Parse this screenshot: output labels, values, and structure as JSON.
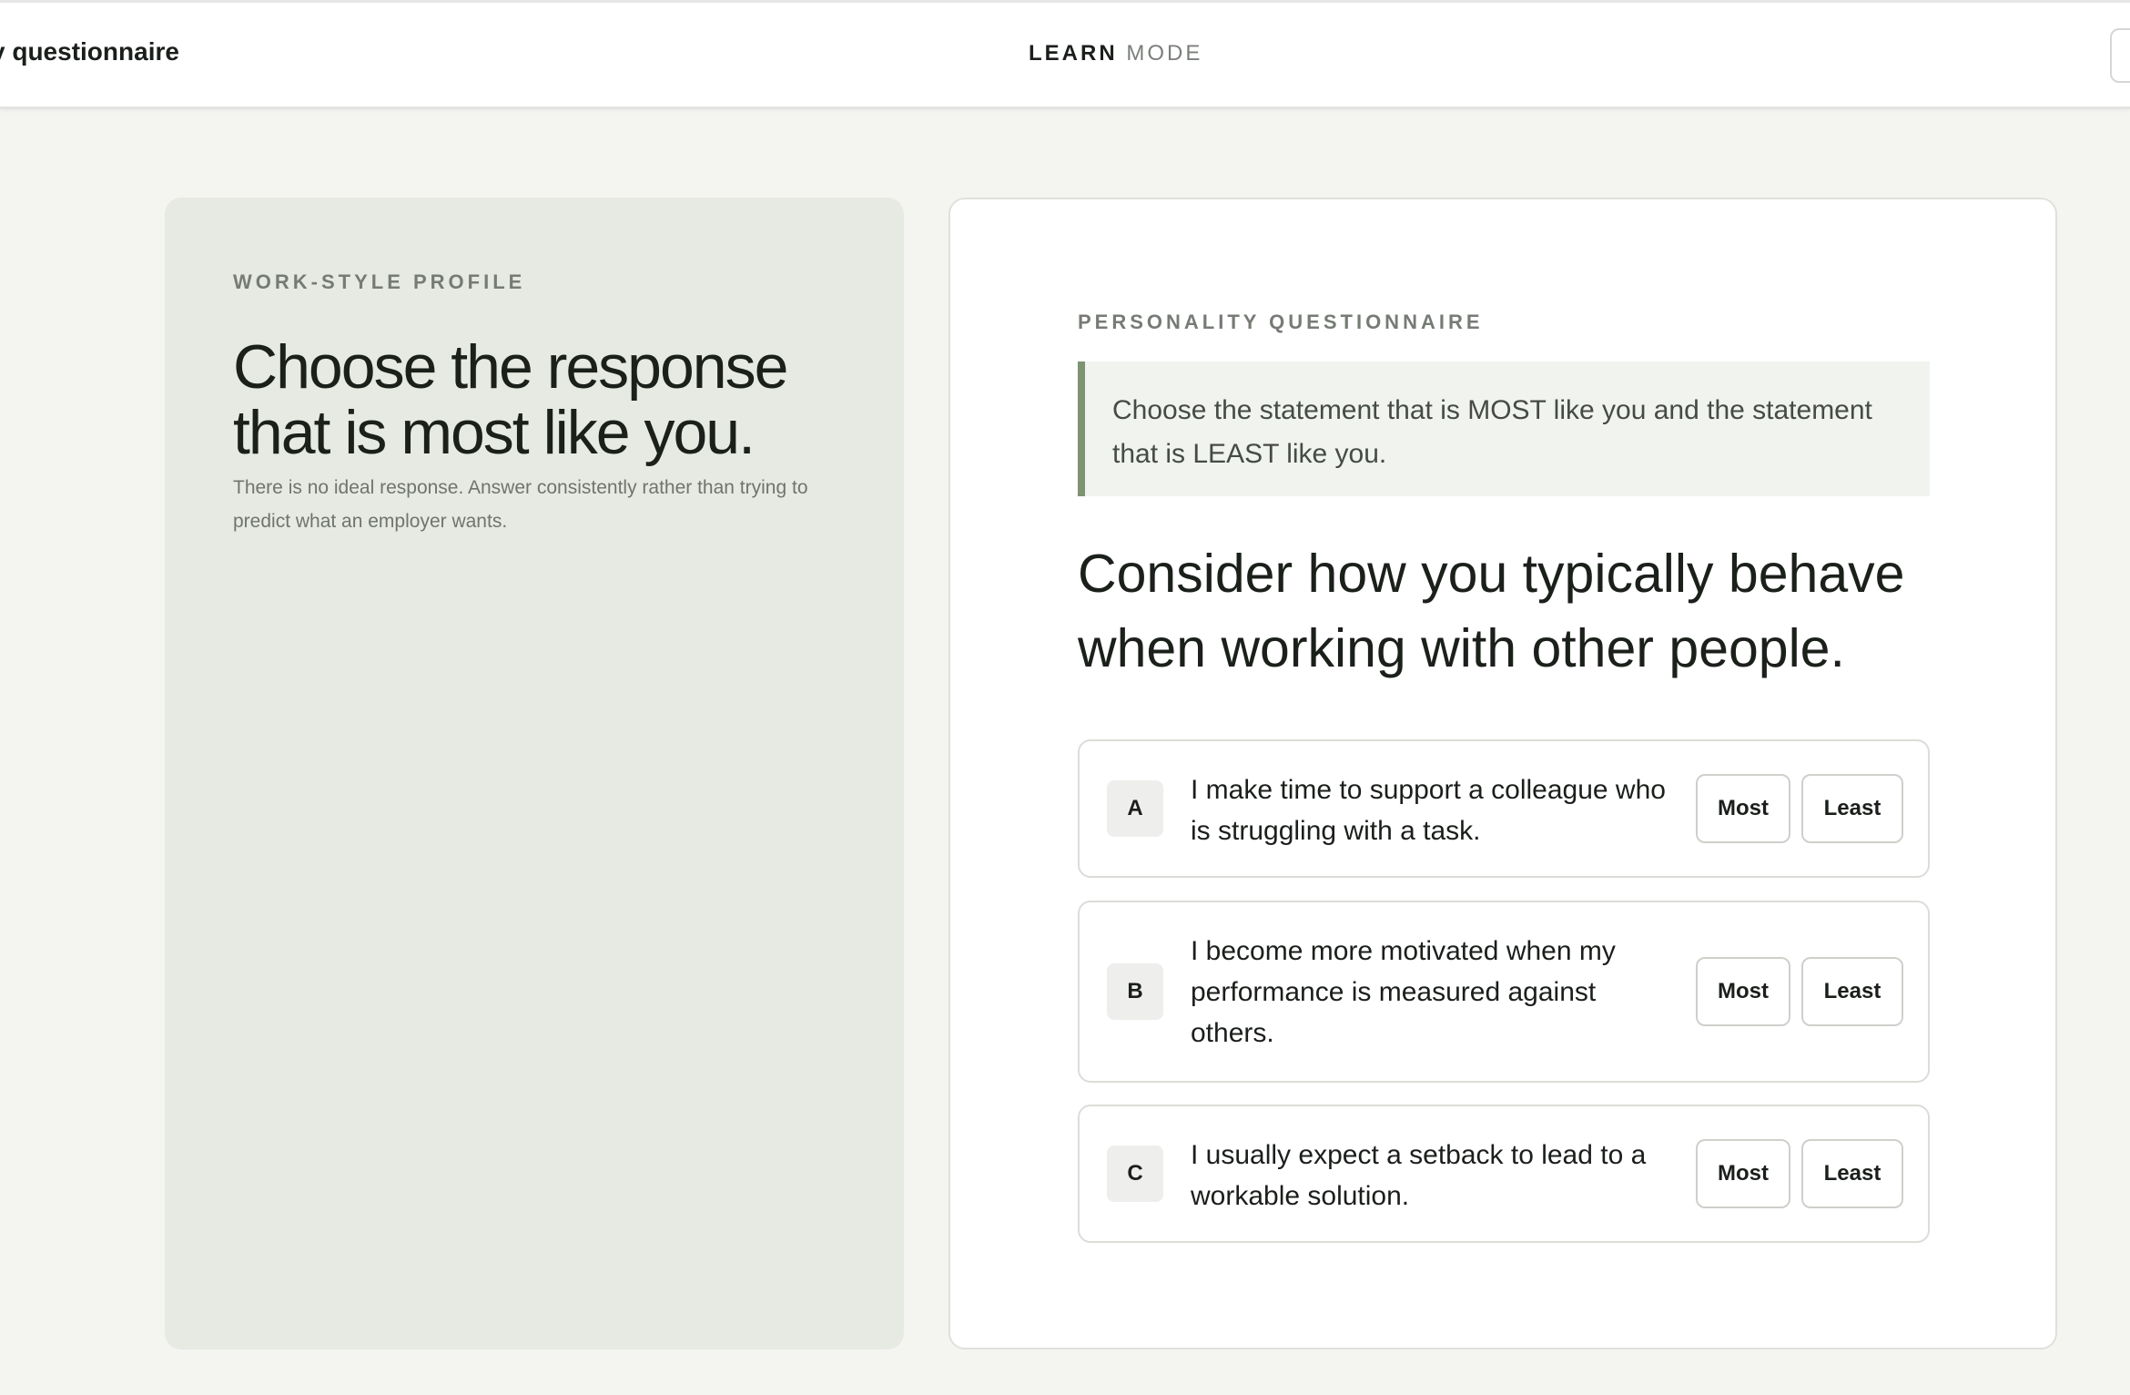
{
  "header": {
    "app_title": "y questionnaire",
    "mode_strong": "LEARN",
    "mode_light": "MODE"
  },
  "left_panel": {
    "eyebrow": "WORK-STYLE PROFILE",
    "heading": "Choose the response that is most like you.",
    "subtext": "There is no ideal response. Answer consistently rather than trying to predict what an employer wants."
  },
  "card": {
    "eyebrow": "PERSONALITY QUESTIONNAIRE",
    "instruction": "Choose the statement that is MOST like you and the statement that is LEAST like you.",
    "question": "Consider how you typically behave when working with other people.",
    "options": [
      {
        "letter": "A",
        "text": "I make time to support a colleague who is struggling with a task.",
        "most_label": "Most",
        "least_label": "Least"
      },
      {
        "letter": "B",
        "text": "I become more motivated when my performance is measured against others.",
        "most_label": "Most",
        "least_label": "Least"
      },
      {
        "letter": "C",
        "text": "I usually expect a setback to lead to a workable solution.",
        "most_label": "Most",
        "least_label": "Least"
      }
    ]
  },
  "colors": {
    "page_background": "#f4f4f1",
    "left_panel_background": "#e7eae2",
    "instruction_accent": "#7e9372",
    "text_primary": "#1b1f1b"
  }
}
